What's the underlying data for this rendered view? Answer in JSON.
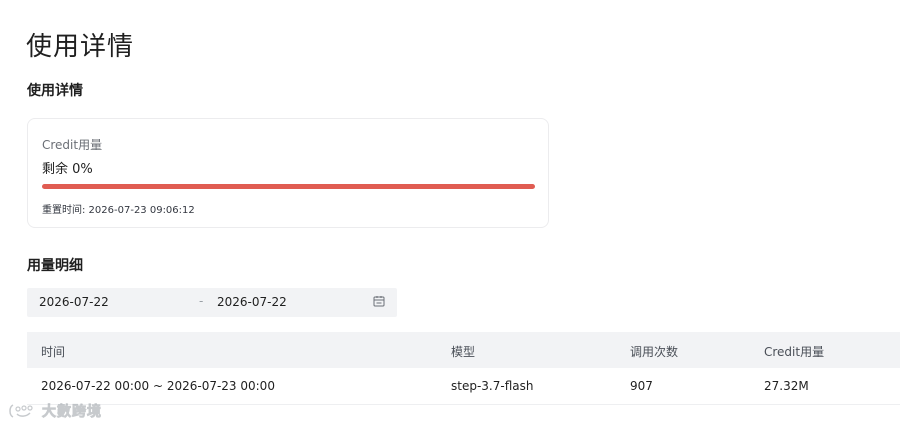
{
  "page": {
    "title": "使用详情"
  },
  "usage": {
    "section_title": "使用详情",
    "card": {
      "label": "Credit用量",
      "remaining_text": "剩余 0%",
      "remaining_percent": 0,
      "reset_text": "重置时间: 2026-07-23 09:06:12",
      "bar_color": "#e05c52"
    }
  },
  "details": {
    "section_title": "用量明细",
    "date_range": {
      "start": "2026-07-22",
      "separator": "-",
      "end": "2026-07-22",
      "icon": "calendar-icon"
    },
    "table": {
      "headers": [
        "时间",
        "模型",
        "调用次数",
        "Credit用量"
      ],
      "rows": [
        [
          "2026-07-22 00:00 ~ 2026-07-23 00:00",
          "step-3.7-flash",
          "907",
          "27.32M"
        ]
      ]
    }
  },
  "watermark": {
    "text": "大數跨境",
    "icon": "watermark-logo-icon"
  }
}
